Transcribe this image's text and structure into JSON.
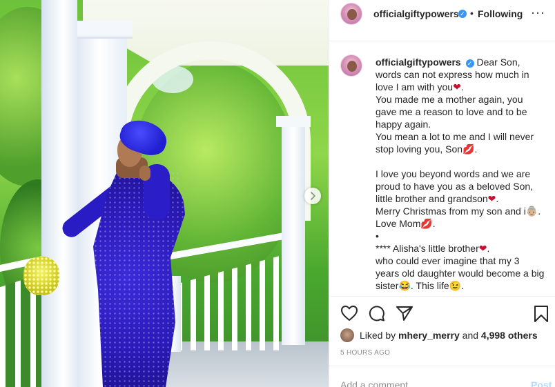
{
  "post": {
    "photo_alt": "Woman in blue sequin dress on white porch",
    "author": {
      "username": "officialgiftypowers",
      "verified": true,
      "follow_status": "Following"
    },
    "caption": {
      "username": "officialgiftypowers",
      "lines": [
        "Dear Son, words can not express how much in love I am with you",
        "You made me a mother again, you gave me a reason to love and to be happy again.",
        "You mean a lot to me and I will never stop loving you, Son",
        "I love you beyond words and we are proud to have you as a beloved Son, little brother and grandson",
        "Merry Christmas from my son and i",
        "Love Mom",
        "•",
        "**** Alisha's little brother",
        "who could ever imagine that my 3 years old daughter would become a big sister",
        "This life"
      ]
    },
    "emojis": {
      "heart": "❤",
      "lips": "💋",
      "grin": "😂",
      "grandma": "👵🏼",
      "wink": "😉"
    },
    "likes": {
      "liked_by_prefix": "Liked by",
      "liked_by_user": "mhery_merry",
      "and_text": "and",
      "others_count": "4,998 others"
    },
    "timestamp": "5 hours ago",
    "comment": {
      "placeholder": "Add a comment...",
      "post_label": "Post"
    }
  },
  "icons": {
    "like": "heart-icon",
    "comment": "comment-icon",
    "share": "share-icon",
    "save": "bookmark-icon",
    "more": "more-icon",
    "next": "chevron-right-icon",
    "verified": "verified-badge-icon"
  },
  "colors": {
    "verified_blue": "#3897f0",
    "text": "#262626",
    "muted": "#8e8e8e",
    "post_disabled": "#b3dbff",
    "border": "#efefef"
  }
}
